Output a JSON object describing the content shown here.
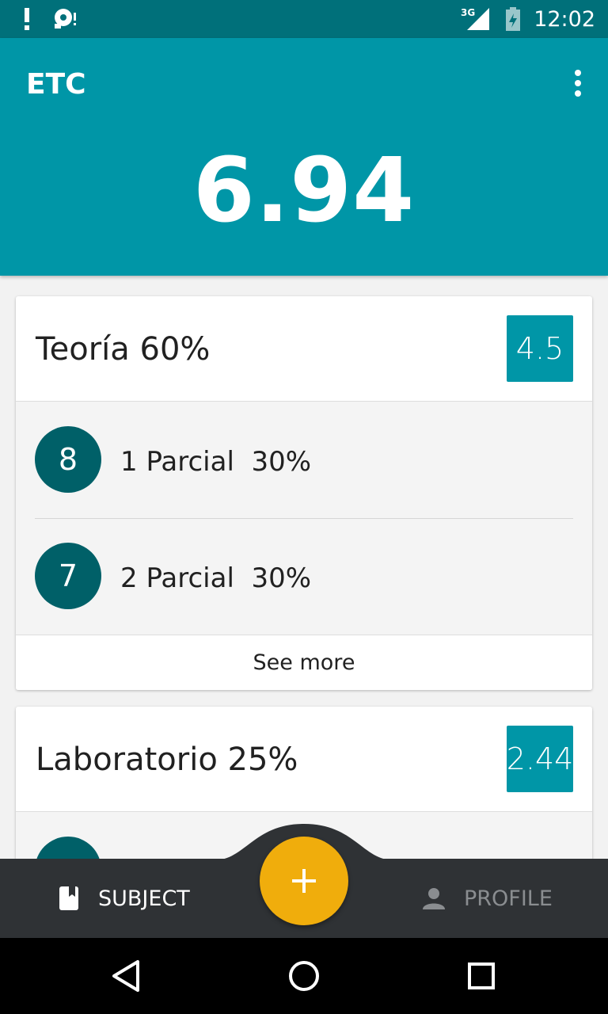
{
  "status_bar": {
    "time": "12:02",
    "network": "3G",
    "icons": [
      "alert-icon",
      "debug-icon",
      "signal-icon",
      "battery-icon"
    ]
  },
  "app_bar": {
    "title": "ETC",
    "overall_grade": "6.94",
    "menu_icon": "more-vert-icon"
  },
  "cards": [
    {
      "name": "Teoría 60%",
      "score": "4.5",
      "items": [
        {
          "grade": "8",
          "label": "1 Parcial  30%"
        },
        {
          "grade": "7",
          "label": "2 Parcial  30%"
        }
      ],
      "see_more": "See more"
    },
    {
      "name": "Laboratorio 25%",
      "score": "2.44",
      "items": [
        {
          "grade": "",
          "label": ""
        }
      ]
    }
  ],
  "bottom_nav": {
    "subject_label": "SUBJECT",
    "profile_label": "PROFILE",
    "fab_icon": "plus-icon"
  },
  "colors": {
    "status_bar": "#00707a",
    "primary": "#0096a7",
    "grade_circle": "#006068",
    "fab": "#f0ad0c",
    "bottom_nav": "#2f3235"
  }
}
